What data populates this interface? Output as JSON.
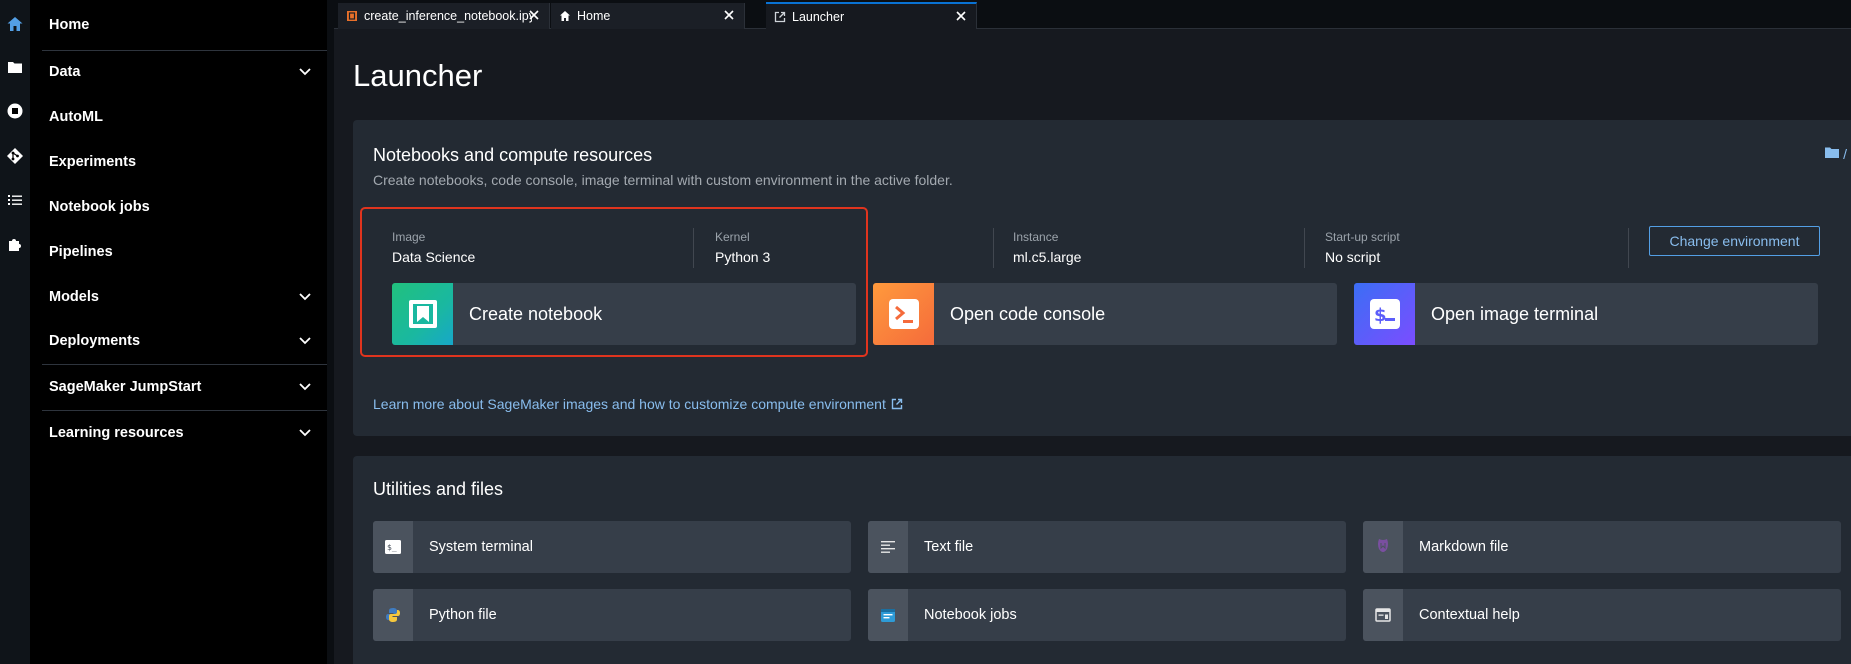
{
  "rail": {
    "icons": [
      "home-icon",
      "folder-icon",
      "stop-circle-icon",
      "git-icon",
      "list-icon",
      "extension-icon"
    ],
    "accent": "#539fe5"
  },
  "sidebar": {
    "items": [
      {
        "label": "Home",
        "expandable": false
      },
      {
        "label": "Data",
        "expandable": true
      },
      {
        "label": "AutoML",
        "expandable": false
      },
      {
        "label": "Experiments",
        "expandable": false
      },
      {
        "label": "Notebook jobs",
        "expandable": false
      },
      {
        "label": "Pipelines",
        "expandable": false
      },
      {
        "label": "Models",
        "expandable": true
      },
      {
        "label": "Deployments",
        "expandable": true
      },
      {
        "label": "SageMaker JumpStart",
        "expandable": true
      },
      {
        "label": "Learning resources",
        "expandable": true
      }
    ]
  },
  "tabs": [
    {
      "label": "create_inference_notebook.ipynb",
      "icon": "notebook-icon",
      "active": false
    },
    {
      "label": "Home",
      "icon": "home-icon",
      "active": false
    },
    {
      "label": "Launcher",
      "icon": "launcher-icon",
      "active": true
    }
  ],
  "main": {
    "title": "Launcher",
    "notebooks": {
      "title": "Notebooks and compute resources",
      "subtitle": "Create notebooks, code console, image terminal with custom environment in the active folder.",
      "folder": "/",
      "image_label": "Image",
      "image_value": "Data Science",
      "kernel_label": "Kernel",
      "kernel_value": "Python 3",
      "instance_label": "Instance",
      "instance_value": "ml.c5.large",
      "startup_label": "Start-up script",
      "startup_value": "No script",
      "change_env_label": "Change environment",
      "launch": [
        {
          "label": "Create notebook",
          "icon": "notebook-icon",
          "color": "#1ab8a0"
        },
        {
          "label": "Open code console",
          "icon": "terminal-prompt-icon",
          "color": "#f56b3b"
        },
        {
          "label": "Open image terminal",
          "icon": "dollar-terminal-icon",
          "color": "#5b5dfa"
        }
      ],
      "learn_more": "Learn more about SageMaker images and how to customize compute environment",
      "highlight_color": "#e0341e"
    },
    "utilities": {
      "title": "Utilities and files",
      "items": [
        {
          "label": "System terminal",
          "icon": "system-terminal-icon"
        },
        {
          "label": "Text file",
          "icon": "text-file-icon"
        },
        {
          "label": "Markdown file",
          "icon": "markdown-file-icon"
        },
        {
          "label": "Python file",
          "icon": "python-file-icon"
        },
        {
          "label": "Notebook jobs",
          "icon": "notebook-jobs-icon"
        },
        {
          "label": "Contextual help",
          "icon": "contextual-help-icon"
        }
      ]
    }
  }
}
